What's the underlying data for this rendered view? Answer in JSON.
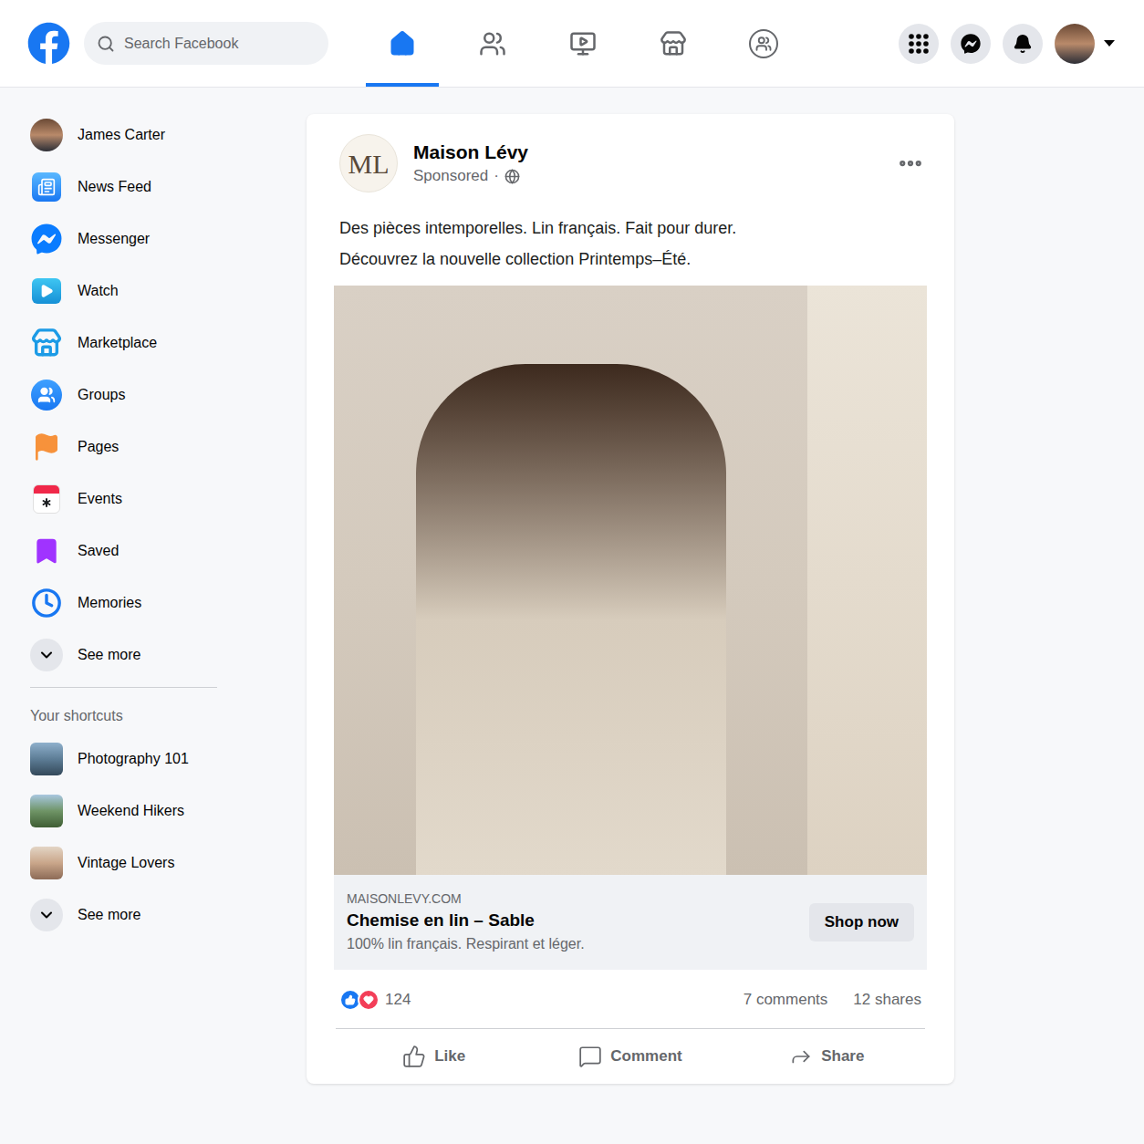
{
  "topbar": {
    "search_placeholder": "Search Facebook",
    "nav": [
      {
        "kind": "home",
        "selected": true
      },
      {
        "kind": "friends",
        "selected": false
      },
      {
        "kind": "watch",
        "selected": false
      },
      {
        "kind": "marketplace",
        "selected": false
      },
      {
        "kind": "groups",
        "selected": false
      }
    ]
  },
  "sidebar": {
    "profile": {
      "name": "James Carter"
    },
    "items": [
      {
        "label": "News Feed",
        "kind": "feed"
      },
      {
        "label": "Messenger",
        "kind": "messenger"
      },
      {
        "label": "Watch",
        "kind": "watch"
      },
      {
        "label": "Marketplace",
        "kind": "marketplace"
      },
      {
        "label": "Groups",
        "kind": "groups"
      },
      {
        "label": "Pages",
        "kind": "pages"
      },
      {
        "label": "Events",
        "kind": "events"
      },
      {
        "label": "Saved",
        "kind": "saved"
      },
      {
        "label": "Memories",
        "kind": "memories"
      }
    ],
    "see_more": "See more",
    "shortcuts_title": "Your shortcuts",
    "shortcuts": [
      {
        "label": "Photography 101"
      },
      {
        "label": "Weekend Hikers"
      },
      {
        "label": "Vintage Lovers"
      }
    ],
    "shortcuts_see_more": "See more"
  },
  "post": {
    "page_name": "Maison Lévy",
    "avatar_initials": "ML",
    "sponsored": "Sponsored",
    "separator": "·",
    "text_lines": [
      "Des pièces intemporelles. Lin français. Fait pour durer.",
      "Découvrez la nouvelle collection Printemps–Été."
    ],
    "link": {
      "domain": "MAISONLEVY.COM",
      "title": "Chemise en lin – Sable",
      "description": "100% lin français. Respirant et léger.",
      "button": "Shop now"
    },
    "reactions": {
      "count": "124"
    },
    "comments": "7 comments",
    "shares": "12 shares",
    "actions": [
      {
        "label": "Like",
        "kind": "like"
      },
      {
        "label": "Comment",
        "kind": "comment"
      },
      {
        "label": "Share",
        "kind": "share"
      }
    ]
  }
}
